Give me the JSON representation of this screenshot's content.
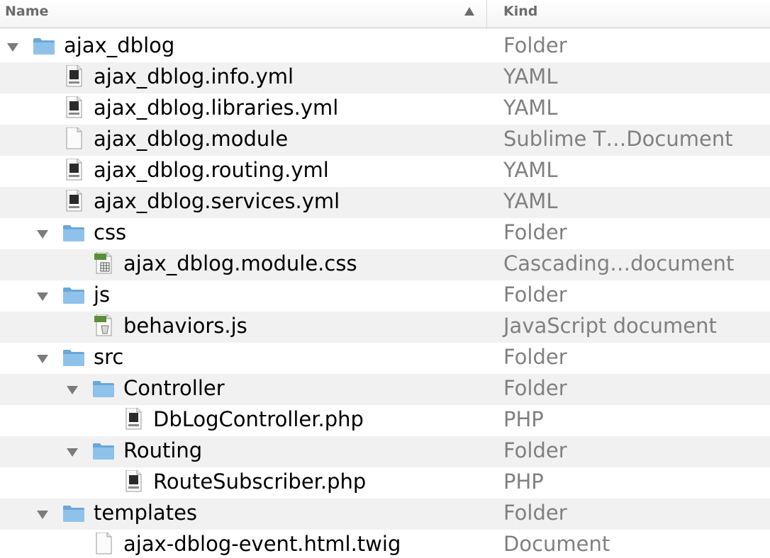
{
  "header": {
    "name_label": "Name",
    "kind_label": "Kind"
  },
  "colors": {
    "folder_blue": "#8fc2ea",
    "folder_dark": "#6aa7d9",
    "row_alt": "#f1f1f2",
    "kind_text": "#808080",
    "css_badge": "#5a8f3a",
    "js_badge": "#5a8f3a"
  },
  "rows": [
    {
      "name": "ajax_dblog",
      "kind": "Folder",
      "icon": "folder-icon",
      "level": 0,
      "expanded": true
    },
    {
      "name": "ajax_dblog.info.yml",
      "kind": "YAML",
      "icon": "yaml-file-icon",
      "level": 1
    },
    {
      "name": "ajax_dblog.libraries.yml",
      "kind": "YAML",
      "icon": "yaml-file-icon",
      "level": 1
    },
    {
      "name": "ajax_dblog.module",
      "kind": "Sublime T…Document",
      "icon": "document-icon",
      "level": 1
    },
    {
      "name": "ajax_dblog.routing.yml",
      "kind": "YAML",
      "icon": "yaml-file-icon",
      "level": 1
    },
    {
      "name": "ajax_dblog.services.yml",
      "kind": "YAML",
      "icon": "yaml-file-icon",
      "level": 1
    },
    {
      "name": "css",
      "kind": "Folder",
      "icon": "folder-icon",
      "level": 1,
      "expanded": true
    },
    {
      "name": "ajax_dblog.module.css",
      "kind": "Cascading…document",
      "icon": "css-file-icon",
      "level": 2
    },
    {
      "name": "js",
      "kind": "Folder",
      "icon": "folder-icon",
      "level": 1,
      "expanded": true
    },
    {
      "name": "behaviors.js",
      "kind": "JavaScript document",
      "icon": "js-file-icon",
      "level": 2
    },
    {
      "name": "src",
      "kind": "Folder",
      "icon": "folder-icon",
      "level": 1,
      "expanded": true
    },
    {
      "name": "Controller",
      "kind": "Folder",
      "icon": "folder-icon",
      "level": 2,
      "expanded": true
    },
    {
      "name": "DbLogController.php",
      "kind": "PHP",
      "icon": "php-file-icon",
      "level": 3
    },
    {
      "name": "Routing",
      "kind": "Folder",
      "icon": "folder-icon",
      "level": 2,
      "expanded": true
    },
    {
      "name": "RouteSubscriber.php",
      "kind": "PHP",
      "icon": "php-file-icon",
      "level": 3
    },
    {
      "name": "templates",
      "kind": "Folder",
      "icon": "folder-icon",
      "level": 1,
      "expanded": true
    },
    {
      "name": "ajax-dblog-event.html.twig",
      "kind": "Document",
      "icon": "document-icon",
      "level": 2
    }
  ]
}
